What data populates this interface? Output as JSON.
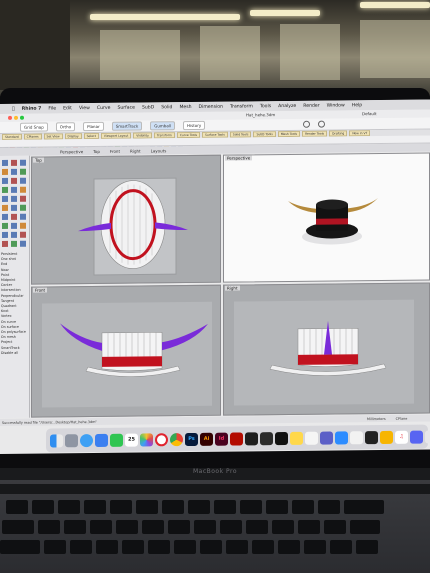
{
  "menu_bar": {
    "app_name": "Rhino 7",
    "items": [
      "File",
      "Edit",
      "View",
      "Curve",
      "Surface",
      "SubD",
      "Solid",
      "Mesh",
      "Dimension",
      "Transform",
      "Tools",
      "Analyze",
      "Render",
      "Window",
      "Help"
    ]
  },
  "window": {
    "title": "Hat_hehe.3dm",
    "display_mode": "Default"
  },
  "rhino_toolbar": {
    "tabs": [
      "Grid Snap",
      "Ortho",
      "Planar",
      "SmartTrack",
      "Gumball",
      "History"
    ],
    "active": [
      "SmartTrack",
      "Gumball"
    ]
  },
  "command_tabs": [
    "Standard",
    "CPlanes",
    "Set View",
    "Display",
    "Select",
    "Viewport Layout",
    "Visibility",
    "Transform",
    "Curve Tools",
    "Surface Tools",
    "Solid Tools",
    "SubD Tools",
    "Mesh Tools",
    "Render Tools",
    "Drafting",
    "New in V7"
  ],
  "viewport_tabs": [
    "Perspective",
    "Top",
    "Front",
    "Right",
    "Layouts"
  ],
  "viewports": {
    "top": "Top",
    "perspective": "Perspective",
    "front": "Front",
    "right": "Right"
  },
  "osnaps": [
    "Persistent",
    "One shot",
    "End",
    "Near",
    "Point",
    "Midpoint",
    "Center",
    "Intersection",
    "Perpendicular",
    "Tangent",
    "Quadrant",
    "Knot",
    "Vertex",
    "On curve",
    "On surface",
    "On polysurface",
    "On mesh",
    "Project",
    "SmartTrack",
    "Disable all"
  ],
  "status_bar": {
    "message": "Successfully read file \"/Users/...Desktop/Hat_hehe.3dm\"",
    "units": "Millimeters",
    "plane": "CPlane"
  },
  "dock": {
    "calendar_day": "25",
    "apps": [
      "Finder",
      "Launchpad",
      "Safari",
      "Mail",
      "Messages",
      "Calendar",
      "Photos",
      "Opera",
      "Chrome",
      "Photoshop",
      "Illustrator",
      "InDesign",
      "Acrobat",
      "Figma",
      "Rhino",
      "TV",
      "Notes",
      "Teams",
      "Zoom",
      "Discord"
    ]
  },
  "hardware": {
    "brand": "MacBook Pro"
  },
  "colors": {
    "hat_body": "#e8e8ea",
    "hat_band": "#c1121f",
    "horns_selected": "#7a2bd9",
    "horns_render": "#b58a3c",
    "hat_render": "#121212"
  }
}
